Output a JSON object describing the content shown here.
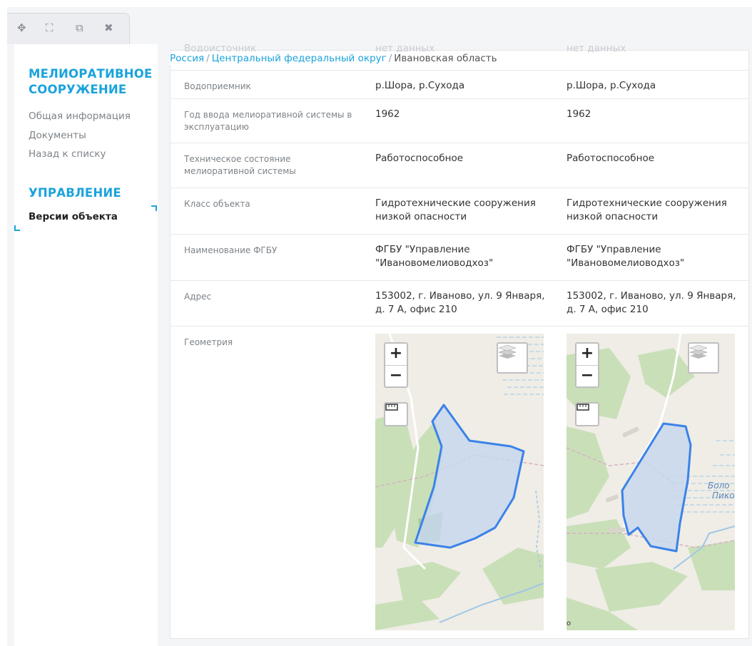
{
  "toolbar": {
    "icons": [
      "move-icon",
      "expand-icon",
      "external-link-icon",
      "close-icon"
    ],
    "glyphs": [
      "✥",
      "⛶",
      "⧉",
      "✖"
    ]
  },
  "sidebar": {
    "section1_title_line1": "МЕЛИОРАТИВНОЕ",
    "section1_title_line2": "СООРУЖЕНИЕ",
    "links": [
      "Общая информация",
      "Документы",
      "Назад к списку"
    ],
    "section2_title": "УПРАВЛЕНИЕ",
    "active_item": "Версии объекта"
  },
  "breadcrumb": {
    "items": [
      "Россия",
      "Центральный федеральный округ"
    ],
    "separator": "/",
    "current": "Ивановская область"
  },
  "ghost_row": {
    "label": "Водоисточник",
    "v1": "нет данных",
    "v2": "нет данных"
  },
  "table": {
    "rows": [
      {
        "label": "Водоприемник",
        "v1": "р.Шора, р.Сухода",
        "v2": "р.Шора, р.Сухода"
      },
      {
        "label": "Год ввода мелиоративной системы в эксплуатацию",
        "v1": "1962",
        "v2": "1962"
      },
      {
        "label": "Техническое состояние мелиоративной системы",
        "v1": "Работоспособное",
        "v2": "Работоспособное"
      },
      {
        "label": "Класс объекта",
        "v1": "Гидротехнические сооружения низкой опасности",
        "v2": "Гидротехнические сооружения низкой опасности"
      },
      {
        "label": "Наименование ФГБУ",
        "v1": "ФГБУ \"Управление \"Ивановомелиоводхоз\"",
        "v2": "ФГБУ \"Управление \"Ивановомелиоводхоз\""
      },
      {
        "label": "Адрес",
        "v1": "153002, г. Иваново, ул. 9 Января, д. 7 А, офис 210",
        "v2": "153002, г. Иваново, ул. 9 Января, д. 7 А, офис 210"
      },
      {
        "label": "Геометрия",
        "v1": "",
        "v2": ""
      }
    ]
  },
  "map": {
    "zoom_in": "+",
    "zoom_out": "−",
    "label_line1": "Боло",
    "label_line2": "Пико",
    "attribution": "o",
    "colors": {
      "polygon_fill": "#c7d7ec",
      "polygon_stroke": "#3b82e8",
      "forest": "#c9dfb8",
      "water": "#9fc6e8",
      "road": "#ffffff"
    }
  },
  "colors": {
    "accent": "#1aa3dc",
    "background": "#f4f5f7"
  }
}
